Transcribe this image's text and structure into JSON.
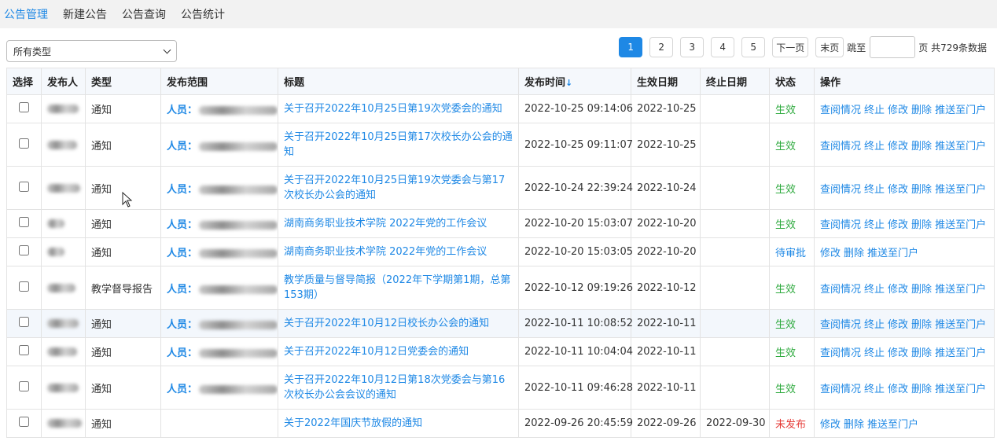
{
  "nav": {
    "items": [
      "公告管理",
      "新建公告",
      "公告查询",
      "公告统计"
    ]
  },
  "filter": {
    "type_select": "所有类型"
  },
  "pagination": {
    "pages": [
      "1",
      "2",
      "3",
      "4",
      "5"
    ],
    "current": "1",
    "next": "下一页",
    "last": "末页",
    "jump_label": "跳至",
    "jump_value": "",
    "summary": "页 共729条数据"
  },
  "table": {
    "headers": {
      "select": "选择",
      "publisher": "发布人",
      "type": "类型",
      "scope": "发布范围",
      "title": "标题",
      "publish_time": "发布时间",
      "effective_date": "生效日期",
      "end_date": "终止日期",
      "status": "状态",
      "actions": "操作"
    },
    "rows": [
      {
        "type": "通知",
        "scope": "人员：",
        "title": "关于召开2022年10月25日第19次党委会的通知",
        "time": "2022-10-25 09:14:06",
        "effective": "2022-10-25",
        "end": "",
        "status": "生效",
        "actions": [
          "查阅情况",
          "终止",
          "修改",
          "删除",
          "推送至门户"
        ]
      },
      {
        "type": "通知",
        "scope": "人员：",
        "title": "关于召开2022年10月25日第17次校长办公会的通知",
        "time": "2022-10-25 09:11:07",
        "effective": "2022-10-25",
        "end": "",
        "status": "生效",
        "actions": [
          "查阅情况",
          "终止",
          "修改",
          "删除",
          "推送至门户"
        ]
      },
      {
        "type": "通知",
        "scope": "人员：",
        "title": "关于召开2022年10月25日第19次党委会与第17次校长办公会的通知",
        "time": "2022-10-24 22:39:24",
        "effective": "2022-10-24",
        "end": "",
        "status": "生效",
        "actions": [
          "查阅情况",
          "终止",
          "修改",
          "删除",
          "推送至门户"
        ]
      },
      {
        "type": "通知",
        "scope": "人员：",
        "title": "湖南商务职业技术学院 2022年党的工作会议",
        "time": "2022-10-20 15:03:07",
        "effective": "2022-10-20",
        "end": "",
        "status": "生效",
        "actions": [
          "查阅情况",
          "终止",
          "修改",
          "删除",
          "推送至门户"
        ]
      },
      {
        "type": "通知",
        "scope": "人员：",
        "title": "湖南商务职业技术学院 2022年党的工作会议",
        "time": "2022-10-20 15:03:05",
        "effective": "2022-10-20",
        "end": "",
        "status": "待审批",
        "actions": [
          "修改",
          "删除",
          "推送至门户"
        ]
      },
      {
        "type": "教学督导报告",
        "scope": "人员：",
        "title": "教学质量与督导简报（2022年下学期第1期，总第153期）",
        "time": "2022-10-12 09:19:26",
        "effective": "2022-10-12",
        "end": "",
        "status": "生效",
        "actions": [
          "查阅情况",
          "终止",
          "修改",
          "删除",
          "推送至门户"
        ]
      },
      {
        "type": "通知",
        "scope": "人员：",
        "title": "关于召开2022年10月12日校长办公会的通知",
        "time": "2022-10-11 10:08:52",
        "effective": "2022-10-11",
        "end": "",
        "status": "生效",
        "actions": [
          "查阅情况",
          "终止",
          "修改",
          "删除",
          "推送至门户"
        ]
      },
      {
        "type": "通知",
        "scope": "人员：",
        "title": "关于召开2022年10月12日党委会的通知",
        "time": "2022-10-11 10:04:04",
        "effective": "2022-10-11",
        "end": "",
        "status": "生效",
        "actions": [
          "查阅情况",
          "终止",
          "修改",
          "删除",
          "推送至门户"
        ]
      },
      {
        "type": "通知",
        "scope": "人员：",
        "title": "关于召开2022年10月12日第18次党委会与第16次校长办公会会议的通知",
        "time": "2022-10-11 09:46:28",
        "effective": "2022-10-11",
        "end": "",
        "status": "生效",
        "actions": [
          "查阅情况",
          "终止",
          "修改",
          "删除",
          "推送至门户"
        ]
      },
      {
        "type": "通知",
        "scope": "",
        "title": "关于2022年国庆节放假的通知",
        "time": "2022-09-26 20:45:59",
        "effective": "2022-09-26",
        "end": "2022-09-30",
        "status": "未发布",
        "actions": [
          "修改",
          "删除",
          "推送至门户"
        ]
      }
    ]
  },
  "colors": {
    "accent": "#1e88e5",
    "status_active": "#2eaa3e",
    "status_unpublished": "#e53935"
  }
}
